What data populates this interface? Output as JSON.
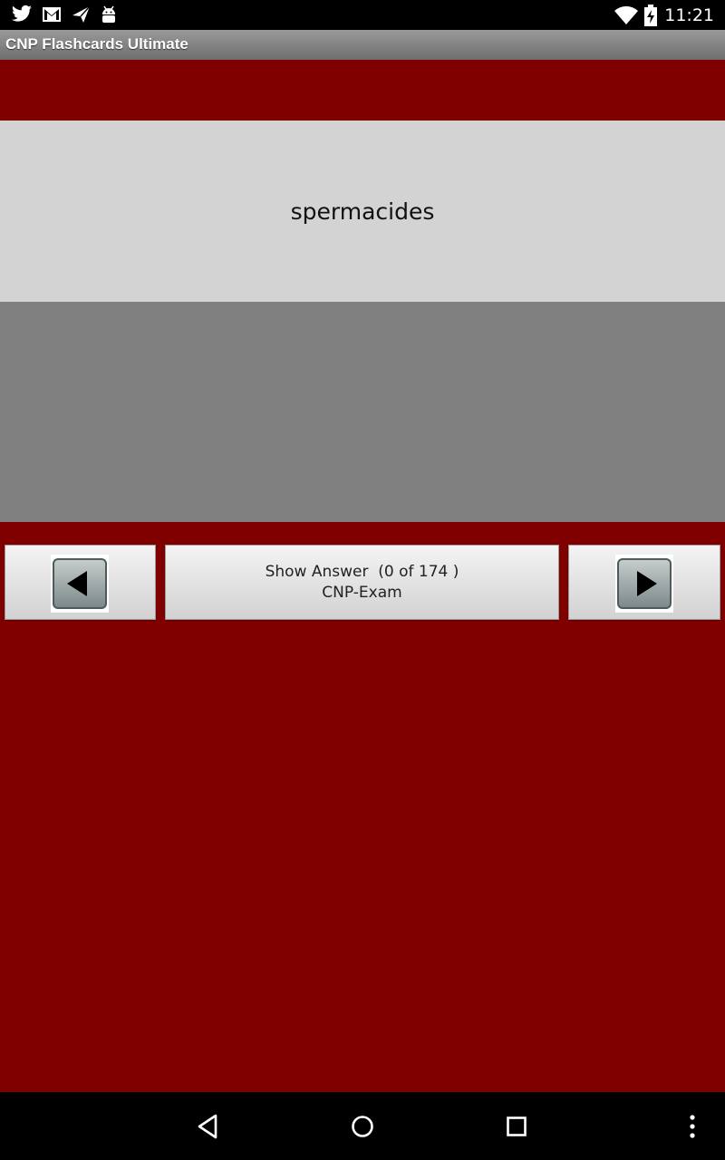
{
  "status_bar": {
    "time": "11:21",
    "notifications": [
      "twitter-icon",
      "gmail-icon",
      "send-icon",
      "android-icon"
    ],
    "indicators": [
      "wifi-icon",
      "battery-charging-icon"
    ]
  },
  "app": {
    "title": "CNP Flashcards Ultimate"
  },
  "card": {
    "term": "spermacides"
  },
  "controls": {
    "show_answer_line1": "Show Answer  (0 of 174 )",
    "show_answer_line2": "CNP-Exam",
    "prev_icon": "left-arrow-icon",
    "next_icon": "right-arrow-icon"
  },
  "nav_bar": {
    "buttons": [
      "back-icon",
      "home-icon",
      "recents-icon",
      "overflow-menu-icon"
    ]
  },
  "colors": {
    "background": "#800000",
    "card_front": "#d3d3d3",
    "card_back": "#808080"
  }
}
